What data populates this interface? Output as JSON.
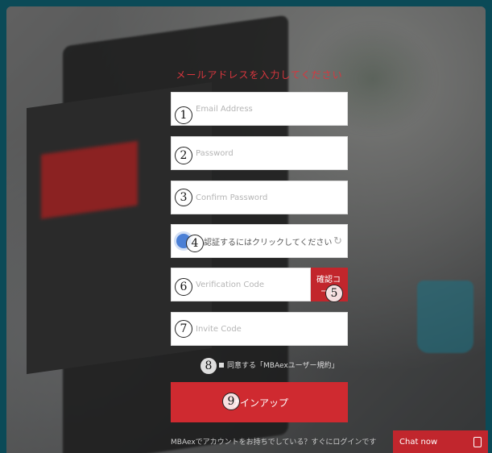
{
  "form": {
    "heading": "メールアドレスを入力してください",
    "email_placeholder": "Email Address",
    "password_placeholder": "Password",
    "confirm_password_placeholder": "Confirm Password",
    "captcha_text": "認証するにはクリックしてください",
    "verification_placeholder": "Verification Code",
    "verify_button_label": "確認コード",
    "invite_placeholder": "Invite Code",
    "agree_text": "同意する「MBAexユーザー規約」",
    "signup_label": "サインアップ",
    "login_link": "MBAexでアカウントをお持ちでしている？すぐにログインです"
  },
  "markers": [
    "1",
    "2",
    "3",
    "4",
    "5",
    "6",
    "7",
    "8",
    "9"
  ],
  "chat": {
    "label": "Chat now",
    "icon": "chat-window-icon"
  },
  "colors": {
    "accent": "#cf2a30",
    "captcha_dot": "#4a7fd6"
  }
}
